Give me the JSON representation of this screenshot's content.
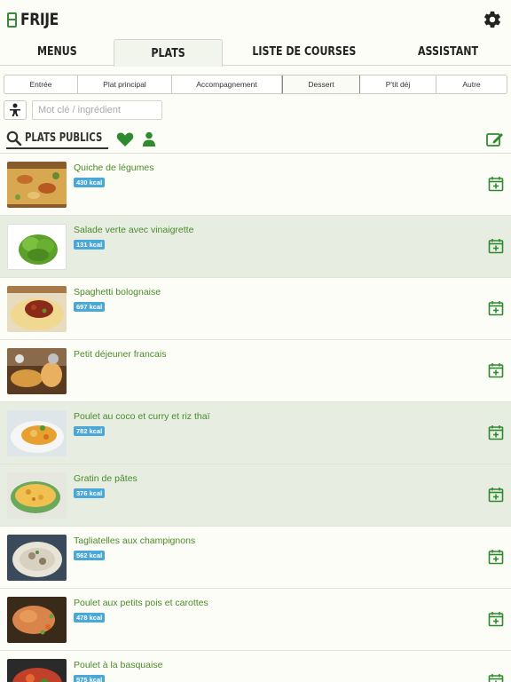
{
  "app": {
    "title": "FRIJE"
  },
  "tabs": [
    {
      "label": "MENUS",
      "active": false
    },
    {
      "label": "PLATS",
      "active": true
    },
    {
      "label": "LISTE DE COURSES",
      "active": false
    },
    {
      "label": "ASSISTANT",
      "active": false
    }
  ],
  "categories": [
    {
      "label": "Entrée",
      "selected": false
    },
    {
      "label": "Plat principal",
      "selected": false
    },
    {
      "label": "Accompagnement",
      "selected": false
    },
    {
      "label": "Dessert",
      "selected": true
    },
    {
      "label": "P'tit déj",
      "selected": false
    },
    {
      "label": "Autre",
      "selected": false
    }
  ],
  "search": {
    "placeholder": "Mot clé / ingrédient",
    "value": ""
  },
  "filter": {
    "public_label": "PLATS PUBLICS"
  },
  "colors": {
    "brand_green": "#3b8a3b",
    "link_green": "#4a8a2a",
    "kcal_blue": "#4aa8d8",
    "row_alt": "#e8ede2"
  },
  "dishes": [
    {
      "name": "Quiche de légumes",
      "kcal": "430 kcal",
      "image": "quiche"
    },
    {
      "name": "Salade verte avec vinaigrette",
      "kcal": "131 kcal",
      "image": "salad"
    },
    {
      "name": "Spaghetti bolognaise",
      "kcal": "697 kcal",
      "image": "spaghetti"
    },
    {
      "name": "Petit déjeuner francais",
      "kcal": "",
      "image": "breakfast"
    },
    {
      "name": "Poulet au coco et curry et riz thaï",
      "kcal": "782 kcal",
      "image": "curry"
    },
    {
      "name": "Gratin de pâtes",
      "kcal": "376 kcal",
      "image": "gratin"
    },
    {
      "name": "Tagliatelles aux champignons",
      "kcal": "562 kcal",
      "image": "tagliatelle"
    },
    {
      "name": "Poulet aux petits pois et carottes",
      "kcal": "478 kcal",
      "image": "chicken-peas"
    },
    {
      "name": "Poulet à la basquaise",
      "kcal": "575 kcal",
      "image": "basquaise"
    }
  ]
}
